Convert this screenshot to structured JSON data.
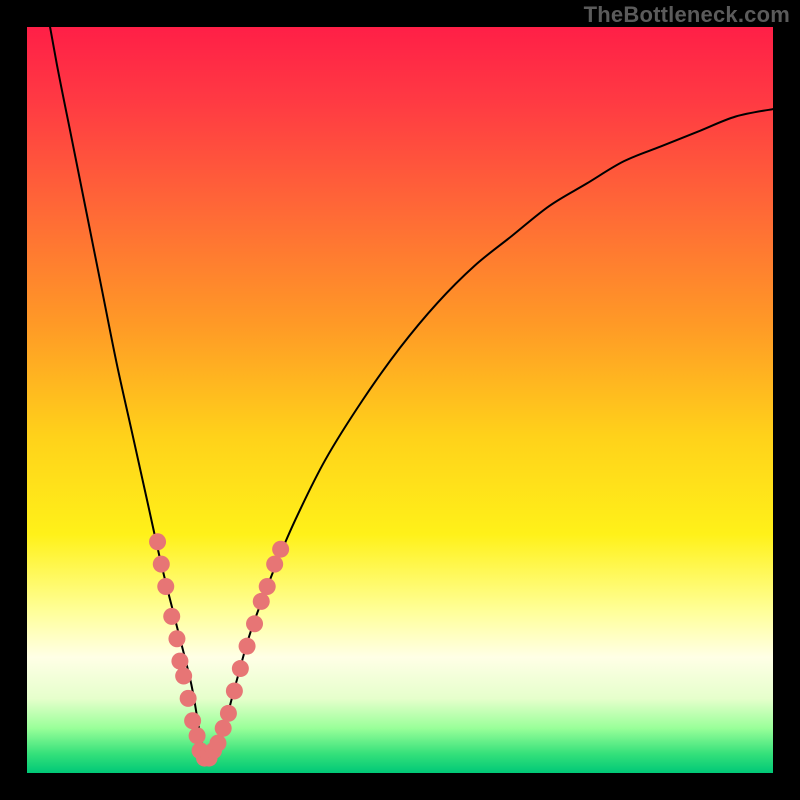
{
  "attribution": "TheBottleneck.com",
  "colors": {
    "frame": "#000000",
    "curve_stroke": "#000000",
    "dot_fill": "#e77575",
    "gradient_stops": [
      {
        "offset": 0.0,
        "color": "#ff1f47"
      },
      {
        "offset": 0.1,
        "color": "#ff3a43"
      },
      {
        "offset": 0.25,
        "color": "#ff6a36"
      },
      {
        "offset": 0.4,
        "color": "#ff9a26"
      },
      {
        "offset": 0.55,
        "color": "#ffd21a"
      },
      {
        "offset": 0.68,
        "color": "#fff119"
      },
      {
        "offset": 0.78,
        "color": "#ffff95"
      },
      {
        "offset": 0.845,
        "color": "#ffffe6"
      },
      {
        "offset": 0.9,
        "color": "#e6ffcc"
      },
      {
        "offset": 0.94,
        "color": "#99ff99"
      },
      {
        "offset": 0.975,
        "color": "#33e07a"
      },
      {
        "offset": 1.0,
        "color": "#00c877"
      }
    ]
  },
  "chart_data": {
    "type": "line",
    "title": "",
    "xlabel": "",
    "ylabel": "",
    "xlim": [
      0,
      100
    ],
    "ylim": [
      0,
      100
    ],
    "note": "V-shaped bottleneck curve. y is the mismatch/bottleneck magnitude; minimum near x≈24 where y≈0. Background color encodes y (green low, red high).",
    "series": [
      {
        "name": "bottleneck-curve",
        "x": [
          0,
          2,
          4,
          6,
          8,
          10,
          12,
          14,
          16,
          18,
          20,
          22,
          24,
          26,
          28,
          30,
          33,
          36,
          40,
          45,
          50,
          55,
          60,
          65,
          70,
          75,
          80,
          85,
          90,
          95,
          100
        ],
        "y": [
          118,
          106,
          95,
          85,
          75,
          65,
          55,
          46,
          37,
          28,
          20,
          12,
          2,
          5,
          12,
          19,
          27,
          34,
          42,
          50,
          57,
          63,
          68,
          72,
          76,
          79,
          82,
          84,
          86,
          88,
          89
        ]
      }
    ],
    "dots": {
      "name": "sample-points",
      "note": "Pink dots clustered near the minimum on both branches.",
      "points": [
        {
          "x": 17.5,
          "y": 31
        },
        {
          "x": 18.0,
          "y": 28
        },
        {
          "x": 18.6,
          "y": 25
        },
        {
          "x": 19.4,
          "y": 21
        },
        {
          "x": 20.1,
          "y": 18
        },
        {
          "x": 20.5,
          "y": 15
        },
        {
          "x": 21.0,
          "y": 13
        },
        {
          "x": 21.6,
          "y": 10
        },
        {
          "x": 22.2,
          "y": 7
        },
        {
          "x": 22.8,
          "y": 5
        },
        {
          "x": 23.2,
          "y": 3
        },
        {
          "x": 23.8,
          "y": 2
        },
        {
          "x": 24.4,
          "y": 2
        },
        {
          "x": 25.0,
          "y": 3
        },
        {
          "x": 25.6,
          "y": 4
        },
        {
          "x": 26.3,
          "y": 6
        },
        {
          "x": 27.0,
          "y": 8
        },
        {
          "x": 27.8,
          "y": 11
        },
        {
          "x": 28.6,
          "y": 14
        },
        {
          "x": 29.5,
          "y": 17
        },
        {
          "x": 30.5,
          "y": 20
        },
        {
          "x": 31.4,
          "y": 23
        },
        {
          "x": 32.2,
          "y": 25
        },
        {
          "x": 33.2,
          "y": 28
        },
        {
          "x": 34.0,
          "y": 30
        }
      ]
    }
  }
}
